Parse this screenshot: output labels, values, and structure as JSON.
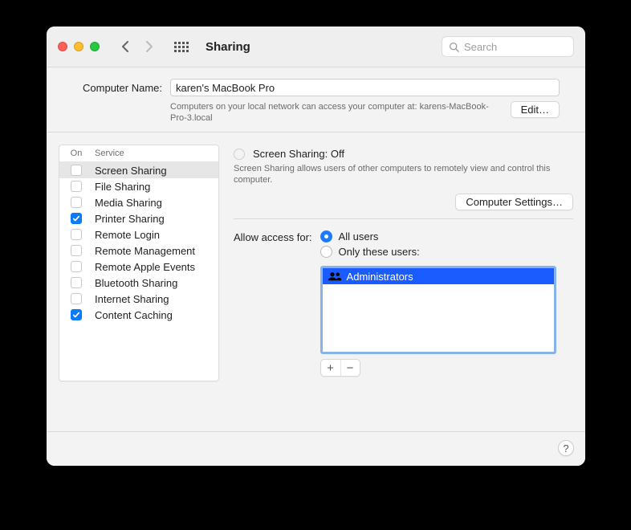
{
  "toolbar": {
    "title": "Sharing",
    "search_placeholder": "Search"
  },
  "computer_name": {
    "label": "Computer Name:",
    "value": "karen's MacBook Pro",
    "note": "Computers on your local network can access your computer at: karens-MacBook-Pro-3.local",
    "edit_label": "Edit…"
  },
  "services": {
    "header_on": "On",
    "header_service": "Service",
    "items": [
      {
        "label": "Screen Sharing",
        "checked": false,
        "selected": true
      },
      {
        "label": "File Sharing",
        "checked": false,
        "selected": false
      },
      {
        "label": "Media Sharing",
        "checked": false,
        "selected": false
      },
      {
        "label": "Printer Sharing",
        "checked": true,
        "selected": false
      },
      {
        "label": "Remote Login",
        "checked": false,
        "selected": false
      },
      {
        "label": "Remote Management",
        "checked": false,
        "selected": false
      },
      {
        "label": "Remote Apple Events",
        "checked": false,
        "selected": false
      },
      {
        "label": "Bluetooth Sharing",
        "checked": false,
        "selected": false
      },
      {
        "label": "Internet Sharing",
        "checked": false,
        "selected": false
      },
      {
        "label": "Content Caching",
        "checked": true,
        "selected": false
      }
    ]
  },
  "detail": {
    "status_title": "Screen Sharing: Off",
    "description": "Screen Sharing allows users of other computers to remotely view and control this computer.",
    "computer_settings_label": "Computer Settings…",
    "allow_label": "Allow access for:",
    "opt_all": "All users",
    "opt_only": "Only these users:",
    "selected_option": "all",
    "users": [
      {
        "label": "Administrators"
      }
    ],
    "add_label": "+",
    "remove_label": "−"
  },
  "help_label": "?"
}
